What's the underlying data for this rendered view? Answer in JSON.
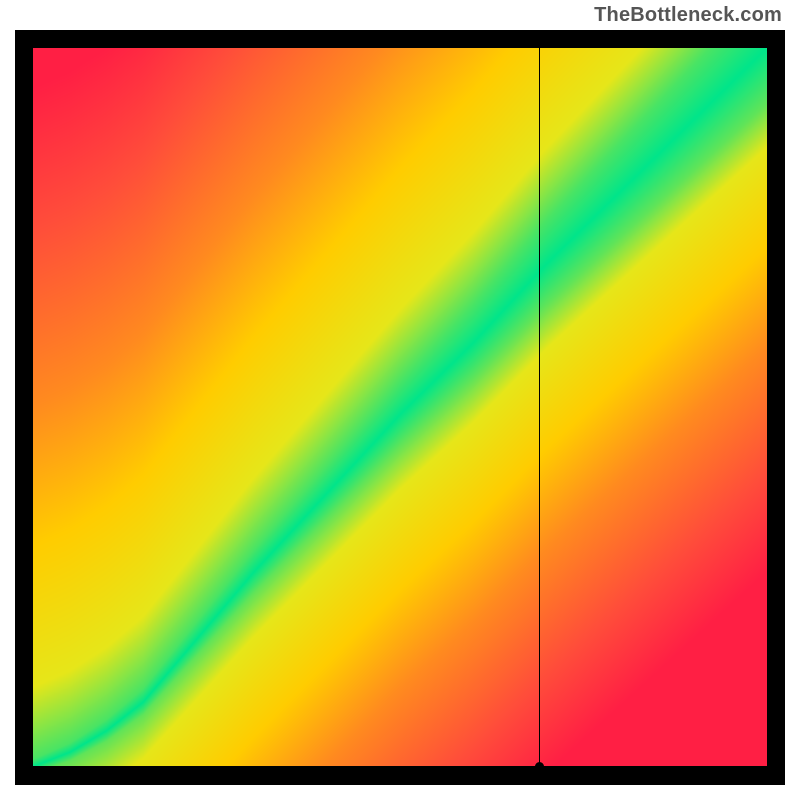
{
  "watermark": "TheBottleneck.com",
  "crosshair": {
    "x_fraction": 0.69,
    "y_fraction": 0.998
  },
  "chart_data": {
    "type": "heatmap",
    "title": "",
    "xlabel": "",
    "ylabel": "",
    "xlim": [
      0,
      1
    ],
    "ylim": [
      0,
      1
    ],
    "description": "Heatmap where green band follows a roughly diagonal optimal curve from bottom-left to top-right; colors transition red→orange→yellow→green→yellow→orange→red as distance from the optimal diagonal increases. A kink near the lower-left makes the green band steeper at low values.",
    "optimal_curve_points": [
      {
        "x": 0.0,
        "y": 0.0
      },
      {
        "x": 0.05,
        "y": 0.02
      },
      {
        "x": 0.1,
        "y": 0.05
      },
      {
        "x": 0.15,
        "y": 0.09
      },
      {
        "x": 0.2,
        "y": 0.15
      },
      {
        "x": 0.3,
        "y": 0.27
      },
      {
        "x": 0.4,
        "y": 0.38
      },
      {
        "x": 0.5,
        "y": 0.49
      },
      {
        "x": 0.6,
        "y": 0.59
      },
      {
        "x": 0.7,
        "y": 0.7
      },
      {
        "x": 0.8,
        "y": 0.8
      },
      {
        "x": 0.9,
        "y": 0.9
      },
      {
        "x": 1.0,
        "y": 1.0
      }
    ],
    "band_half_width_fraction_start": 0.01,
    "band_half_width_fraction_end": 0.08,
    "color_stops": [
      {
        "t": 0.0,
        "color": "#00e58a"
      },
      {
        "t": 0.06,
        "color": "#5ce45a"
      },
      {
        "t": 0.15,
        "color": "#e6e619"
      },
      {
        "t": 0.35,
        "color": "#ffcc00"
      },
      {
        "t": 0.55,
        "color": "#ff8a1f"
      },
      {
        "t": 0.8,
        "color": "#ff4d3a"
      },
      {
        "t": 1.0,
        "color": "#ff1f44"
      }
    ],
    "crosshair_point": {
      "x": 0.69,
      "y": 0.002
    }
  }
}
